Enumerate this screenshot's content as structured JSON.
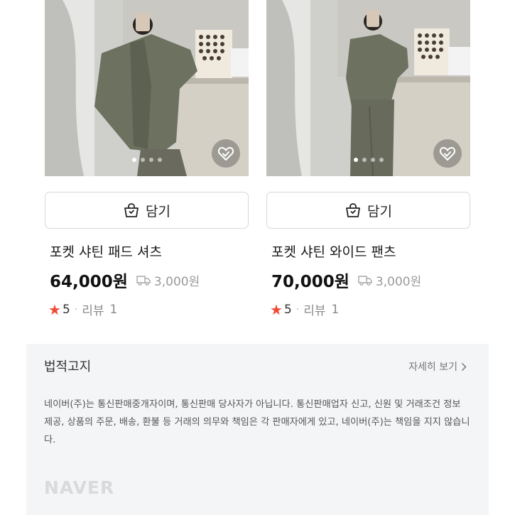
{
  "products": [
    {
      "cart_label": "담기",
      "name": "포켓 샤틴 패드 셔츠",
      "price": "64,000원",
      "shipping": "3,000원",
      "rating": "5",
      "review_label": "리뷰",
      "review_count": "1",
      "image_dots": 4,
      "active_dot": 1
    },
    {
      "cart_label": "담기",
      "name": "포켓 샤틴 와이드 팬츠",
      "price": "70,000원",
      "shipping": "3,000원",
      "rating": "5",
      "review_label": "리뷰",
      "review_count": "1",
      "image_dots": 4,
      "active_dot": 1
    }
  ],
  "footer": {
    "legal_title": "법적고지",
    "more_link": "자세히 보기",
    "legal_text": "네이버(주)는 통신판매중개자이며, 통신판매 당사자가 아닙니다. 통신판매업자 신고, 신원 및 거래조건 정보 제공, 상품의 주문, 배송, 환불 등 거래의 의무와 책임은 각 판매자에게 있고, 네이버(주)는 책임을 지지 않습니다.",
    "logo": "NAVER"
  },
  "colors": {
    "star": "#ef4b36",
    "footer_bg": "#f4f5f7",
    "muted_text": "#9a9a9a"
  },
  "icons": {
    "cart": "shopping-bag-icon",
    "wishlist": "heart-check-icon",
    "shipping": "delivery-truck-icon",
    "rating": "star-icon",
    "more": "chevron-right-icon"
  }
}
